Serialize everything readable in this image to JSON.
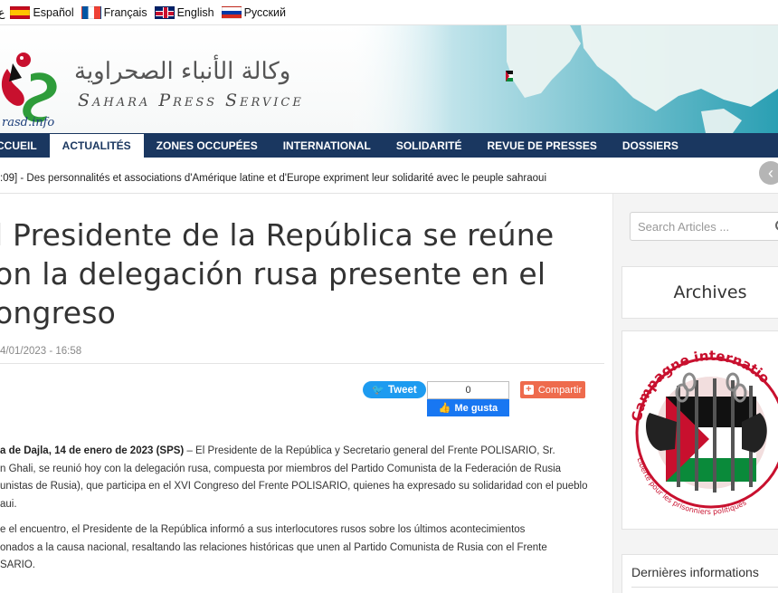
{
  "languages": [
    {
      "label": "Español"
    },
    {
      "label": "Français"
    },
    {
      "label": "English"
    },
    {
      "label": "Русский"
    }
  ],
  "language_stub": "ع",
  "header": {
    "arabic_title": "وكالة الأنباء الصحراوية",
    "latin_title": "Sahara Press Service",
    "domain": "rasd.info"
  },
  "nav": [
    {
      "label": "CCUEIL"
    },
    {
      "label": "ACTUALITÉS"
    },
    {
      "label": "ZONES OCCUPÉES"
    },
    {
      "label": "INTERNATIONAL"
    },
    {
      "label": "SOLIDARITÉ"
    },
    {
      "label": "REVUE DE PRESSES"
    },
    {
      "label": "DOSSIERS"
    }
  ],
  "ticker": {
    "text": ":09] - Des personnalités et associations d'Amérique latine et d'Europe expriment leur solidarité avec le peuple sahraoui"
  },
  "article": {
    "title_line1": "l Presidente de la República se reúne",
    "title_line2": "on la delegación rusa presente en el",
    "title_line3": "ongreso",
    "date": "4/01/2023 - 16:58",
    "para1_lead": "a de Dajla, 14 de enero de 2023 (SPS)",
    "para1_line1_rest": " – El Presidente de la República y Secretario general del Frente POLISARIO, Sr.",
    "para1_line2": "n Ghali, se reunió hoy con la delegación rusa, compuesta por miembros del Partido Comunista de la Federación de Rusia",
    "para1_line3": "unistas de Rusia), que participa en el XVI Congreso del Frente POLISARIO, quienes ha expresado su solidaridad con el pueblo",
    "para1_line4": "aui.",
    "para2_line1": "e el encuentro, el Presidente de la República informó a sus interlocutores rusos sobre los últimos acontecimientos",
    "para2_line2": "onados a la causa nacional, resaltando las relaciones históricas que unen al Partido Comunista de Rusia con el Frente",
    "para2_line3": "SARIO."
  },
  "social": {
    "tweet_label": "Tweet",
    "like_count": "0",
    "like_label": "Me gusta",
    "share_label": "Compartir"
  },
  "sidebar": {
    "search_placeholder": "Search Articles ...",
    "archives_title": "Archives",
    "campaign_text_top": "Campagne internatio",
    "campaign_text_bottom": "Liberté pour les prisonniers politiques",
    "latest_title": "Dernières informations"
  },
  "colors": {
    "nav_bg": "#1a3760",
    "tweet": "#1d9bf0",
    "like": "#1877f2",
    "share": "#ee6b4d"
  }
}
